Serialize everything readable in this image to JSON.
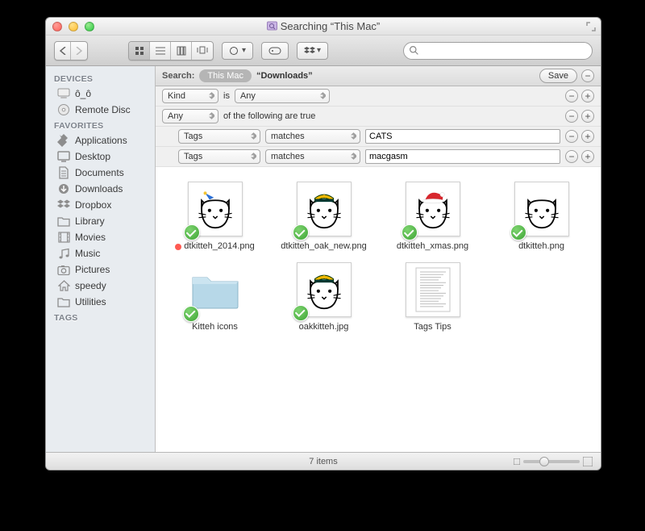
{
  "window": {
    "title": "Searching “This Mac”"
  },
  "sidebar": {
    "sections": [
      {
        "label": "DEVICES",
        "items": [
          {
            "icon": "emoticon",
            "label": "ô_ô"
          },
          {
            "icon": "disc",
            "label": "Remote Disc"
          }
        ]
      },
      {
        "label": "FAVORITES",
        "items": [
          {
            "icon": "applications",
            "label": "Applications"
          },
          {
            "icon": "desktop",
            "label": "Desktop"
          },
          {
            "icon": "documents",
            "label": "Documents"
          },
          {
            "icon": "downloads",
            "label": "Downloads"
          },
          {
            "icon": "dropbox",
            "label": "Dropbox"
          },
          {
            "icon": "folder",
            "label": "Library"
          },
          {
            "icon": "movies",
            "label": "Movies"
          },
          {
            "icon": "music",
            "label": "Music"
          },
          {
            "icon": "pictures",
            "label": "Pictures"
          },
          {
            "icon": "home",
            "label": "speedy"
          },
          {
            "icon": "folder",
            "label": "Utilities"
          }
        ]
      },
      {
        "label": "TAGS",
        "items": []
      }
    ]
  },
  "scope": {
    "label": "Search:",
    "active": "This Mac",
    "other": "“Downloads”",
    "save": "Save"
  },
  "criteria": {
    "row1": {
      "kind": "Kind",
      "is": "is",
      "any": "Any"
    },
    "row2": {
      "any": "Any",
      "text": "of the following are true"
    },
    "row3": {
      "tags": "Tags",
      "matches": "matches",
      "value": "CATS"
    },
    "row4": {
      "tags": "Tags",
      "matches": "matches",
      "value": "macgasm"
    }
  },
  "files": [
    {
      "name": "dtkitteh_2014.png",
      "kind": "cat-blue",
      "reddot": true,
      "badge": true
    },
    {
      "name": "dtkitteh_oak_new.png",
      "kind": "cat-oak",
      "reddot": false,
      "badge": true
    },
    {
      "name": "dtkitteh_xmas.png",
      "kind": "cat-xmas",
      "reddot": false,
      "badge": true
    },
    {
      "name": "dtkitteh.png",
      "kind": "cat-plain",
      "reddot": false,
      "badge": true
    },
    {
      "name": "Kitteh icons",
      "kind": "folder",
      "reddot": false,
      "badge": true
    },
    {
      "name": "oakkitteh.jpg",
      "kind": "cat-oak",
      "reddot": false,
      "badge": true
    },
    {
      "name": "Tags Tips",
      "kind": "doc",
      "reddot": false,
      "badge": false
    }
  ],
  "status": {
    "count": "7 items"
  }
}
